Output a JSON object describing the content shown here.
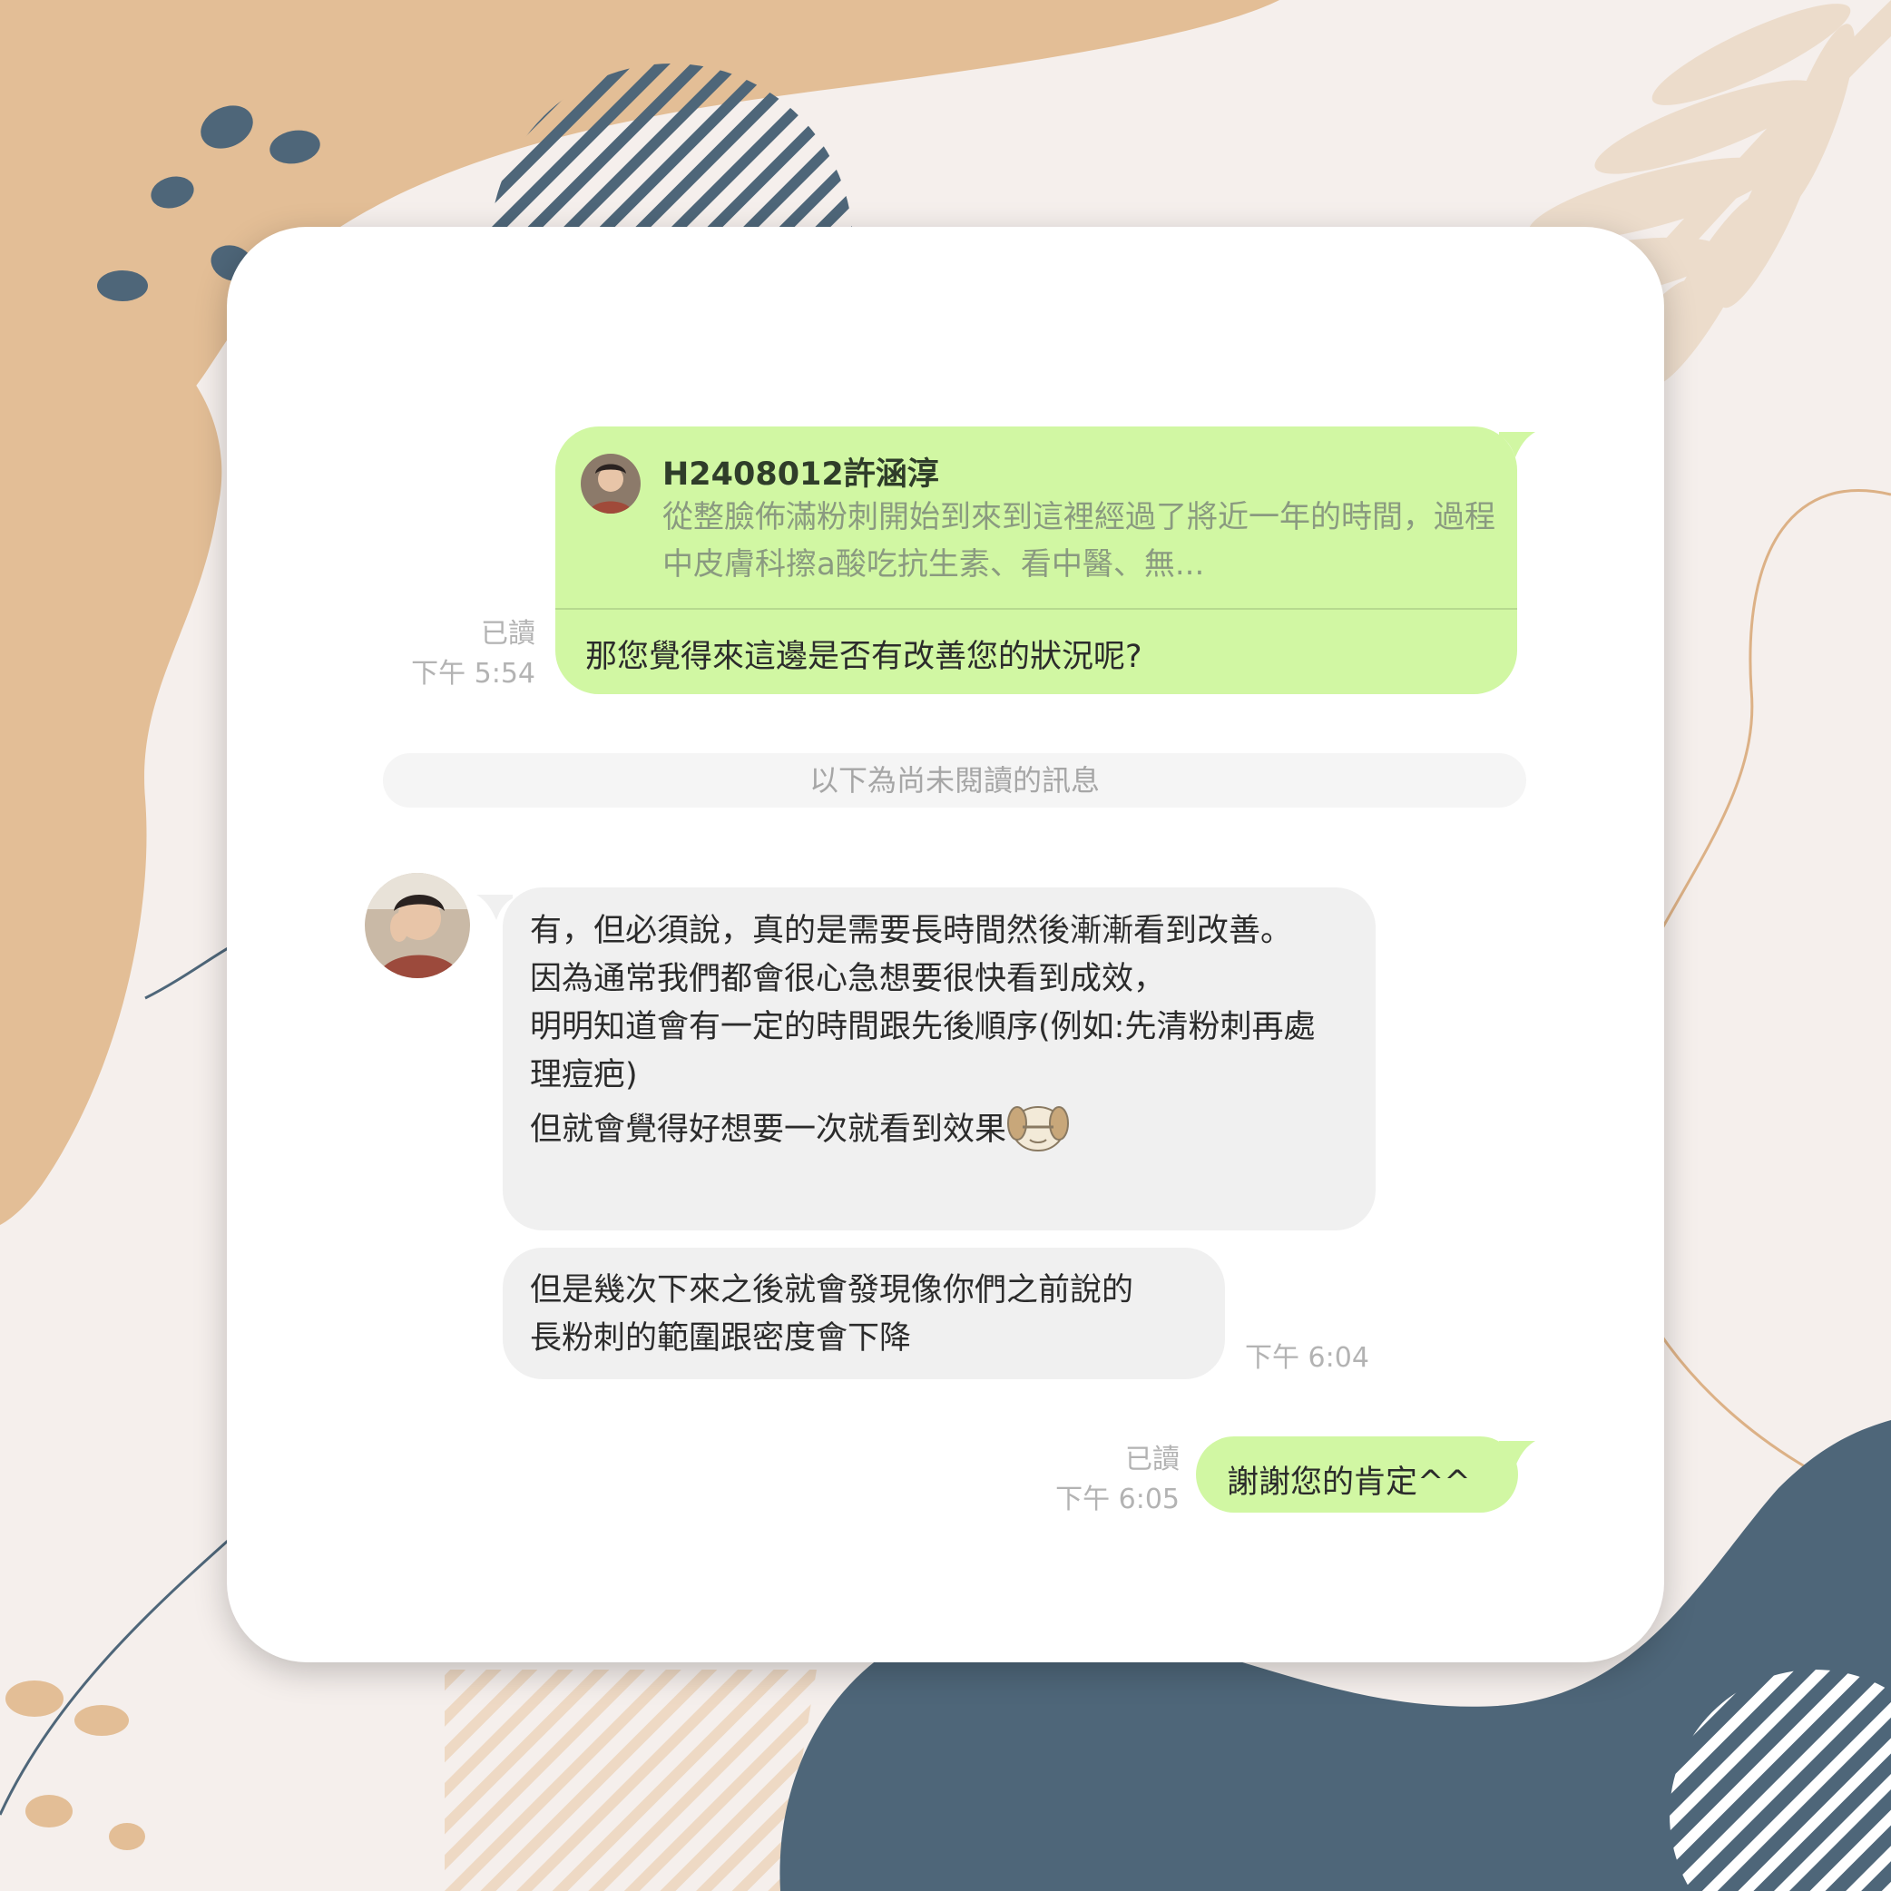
{
  "colors": {
    "outgoing_bubble": "#d1f7a3",
    "incoming_bubble": "#f0f0f0",
    "background": "#f5efec",
    "tan_shape": "#e3be96",
    "navy_shape": "#4e6679"
  },
  "chat": {
    "message1": {
      "quote": {
        "author": "H2408012許涵淳",
        "text": "從整臉佈滿粉刺開始到來到這裡經過了將近一年的時間，過程中皮膚科擦a酸吃抗生素、看中醫、無..."
      },
      "text": "那您覺得來這邊是否有改善您的狀況呢?",
      "read_status": "已讀",
      "time": "下午 5:54"
    },
    "unread_divider": "以下為尚未閱讀的訊息",
    "message2": {
      "lines": [
        "有，但必須說，真的是需要長時間然後漸漸看到改善。",
        "因為通常我們都會很心急想要很快看到成效，",
        "明明知道會有一定的時間跟先後順序(例如:先清粉刺再處理痘疤)",
        "但就會覺得好想要一次就看到效果"
      ],
      "emoji": "facepalm-dog-sticker"
    },
    "message3": {
      "lines": [
        "但是幾次下來之後就會發現像你們之前說的",
        "長粉刺的範圍跟密度會下降"
      ],
      "time": "下午 6:04"
    },
    "message4": {
      "text": "謝謝您的肯定^^",
      "read_status": "已讀",
      "time": "下午 6:05"
    }
  }
}
